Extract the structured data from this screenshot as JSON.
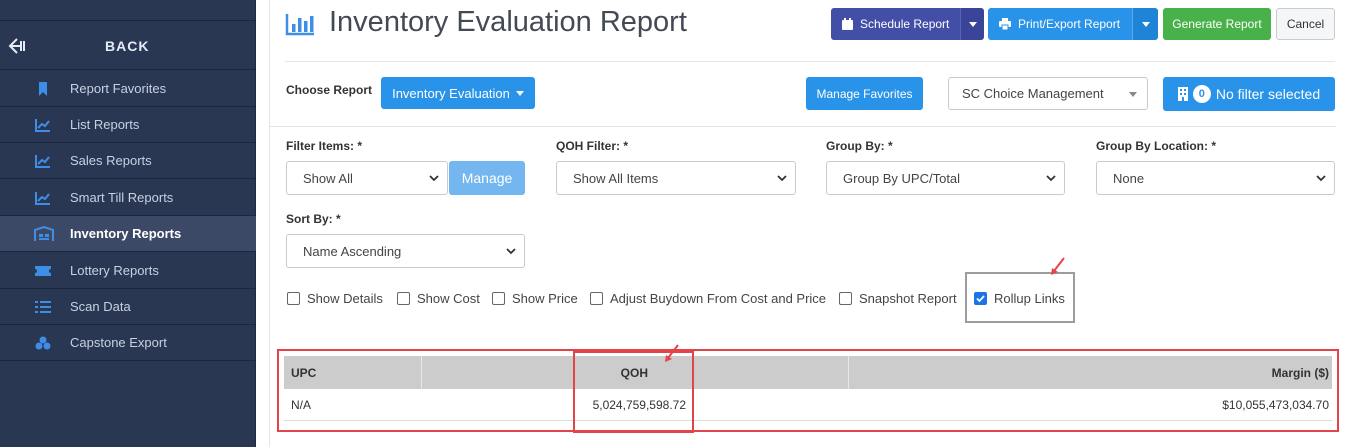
{
  "sidebar": {
    "back_label": "BACK",
    "items": [
      {
        "label": "Report Favorites",
        "icon": "bookmark-icon",
        "active": false
      },
      {
        "label": "List Reports",
        "icon": "line-chart-icon",
        "active": false
      },
      {
        "label": "Sales Reports",
        "icon": "line-chart-icon",
        "active": false
      },
      {
        "label": "Smart Till Reports",
        "icon": "line-chart-icon",
        "active": false
      },
      {
        "label": "Inventory Reports",
        "icon": "warehouse-icon",
        "active": true
      },
      {
        "label": "Lottery Reports",
        "icon": "ticket-icon",
        "active": false
      },
      {
        "label": "Scan Data",
        "icon": "list-icon",
        "active": false
      },
      {
        "label": "Capstone Export",
        "icon": "cubes-icon",
        "active": false
      }
    ]
  },
  "header": {
    "title": "Inventory Evaluation Report",
    "schedule_label": "Schedule Report",
    "print_label": "Print/Export Report",
    "generate_label": "Generate Report",
    "cancel_label": "Cancel"
  },
  "report_bar": {
    "choose_label": "Choose Report",
    "report_value": "Inventory Evaluation",
    "manage_favorites_label": "Manage Favorites",
    "store_value": "SC Choice Management",
    "filter_count": "0",
    "filter_label": "No filter selected"
  },
  "filters": {
    "filter_items_label": "Filter Items: *",
    "filter_items_value": "Show All",
    "manage_label": "Manage",
    "qoh_label": "QOH Filter: *",
    "qoh_value": "Show All Items",
    "group_by_label": "Group By: *",
    "group_by_value": "Group By UPC/Total",
    "group_loc_label": "Group By Location: *",
    "group_loc_value": "None",
    "sort_label": "Sort By: *",
    "sort_value": "Name Ascending"
  },
  "options": [
    {
      "label": "Show Details",
      "checked": false
    },
    {
      "label": "Show Cost",
      "checked": false
    },
    {
      "label": "Show Price",
      "checked": false
    },
    {
      "label": "Adjust Buydown From Cost and Price",
      "checked": false
    },
    {
      "label": "Snapshot Report",
      "checked": false
    },
    {
      "label": "Rollup Links",
      "checked": true
    }
  ],
  "table": {
    "columns": [
      "UPC",
      "QOH",
      "Margin ($)"
    ],
    "rows": [
      {
        "upc": "N/A",
        "qoh": "5,024,759,598.72",
        "margin": "$10,055,473,034.70"
      }
    ]
  },
  "colors": {
    "sidebar_bg": "#2a3753",
    "accent_blue": "#2893e8",
    "accent_purple": "#434ea6",
    "accent_green": "#49b14a",
    "highlight_red": "#e2444a"
  }
}
